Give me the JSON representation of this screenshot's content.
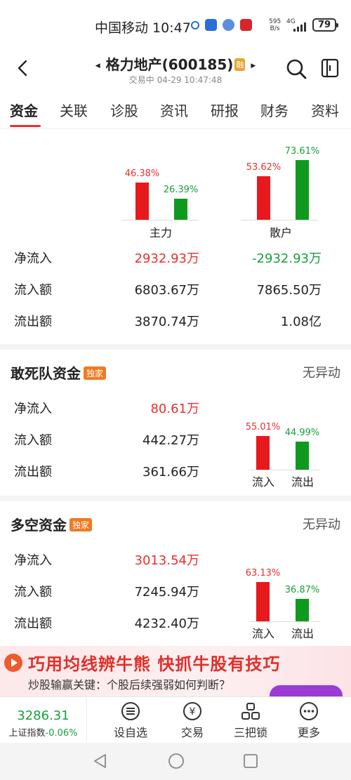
{
  "status_bar": {
    "carrier_time": "中国移动 10:47",
    "net_speed_value": "595",
    "net_speed_unit": "B/s",
    "net_type": "4G",
    "battery": "79"
  },
  "header": {
    "title": "格力地产(600185)",
    "badge": "融",
    "subtitle": "交易中 04-29 10:47:48"
  },
  "tabs": [
    "资金",
    "关联",
    "诊股",
    "资讯",
    "研报",
    "财务",
    "资料"
  ],
  "capital": {
    "categories": [
      "主力",
      "散户"
    ],
    "bars": [
      {
        "label": "46.38%",
        "value": 46.38,
        "color": "red"
      },
      {
        "label": "26.39%",
        "value": 26.39,
        "color": "green"
      },
      {
        "label": "53.62%",
        "value": 53.62,
        "color": "red"
      },
      {
        "label": "73.61%",
        "value": 73.61,
        "color": "green"
      }
    ],
    "rows": [
      {
        "label": "净流入",
        "main": "2932.93万",
        "retail": "-2932.93万"
      },
      {
        "label": "流入额",
        "main": "6803.67万",
        "retail": "7865.50万"
      },
      {
        "label": "流出额",
        "main": "3870.74万",
        "retail": "1.08亿"
      }
    ]
  },
  "dare_to_die": {
    "title": "敢死队资金",
    "badge": "独家",
    "status": "无异动",
    "rows": [
      {
        "label": "净流入",
        "value": "80.61万"
      },
      {
        "label": "流入额",
        "value": "442.27万"
      },
      {
        "label": "流出额",
        "value": "361.66万"
      }
    ],
    "bars": [
      {
        "label": "55.01%",
        "value": 55.01,
        "category": "流入"
      },
      {
        "label": "44.99%",
        "value": 44.99,
        "category": "流出"
      }
    ]
  },
  "long_short": {
    "title": "多空资金",
    "badge": "独家",
    "status": "无异动",
    "rows": [
      {
        "label": "净流入",
        "value": "3013.54万"
      },
      {
        "label": "流入额",
        "value": "7245.94万"
      },
      {
        "label": "流出额",
        "value": "4232.40万"
      }
    ],
    "bars": [
      {
        "label": "63.13%",
        "value": 63.13,
        "category": "流入"
      },
      {
        "label": "36.87%",
        "value": 36.87,
        "category": "流出"
      }
    ]
  },
  "banner": {
    "title": "巧用均线辨牛熊 快抓牛股有技巧",
    "subtitle": "炒股输赢关键：个股后续强弱如何判断？"
  },
  "bottom_bar": {
    "index_value": "3286.31",
    "index_name": "上证指数",
    "index_change": "-0.06%",
    "items": [
      "设自选",
      "交易",
      "三把锁",
      "更多"
    ]
  },
  "colors": {
    "up": "#e8312f",
    "down": "#17a13a",
    "accent": "#e8312f",
    "badge": "#f07a22"
  }
}
